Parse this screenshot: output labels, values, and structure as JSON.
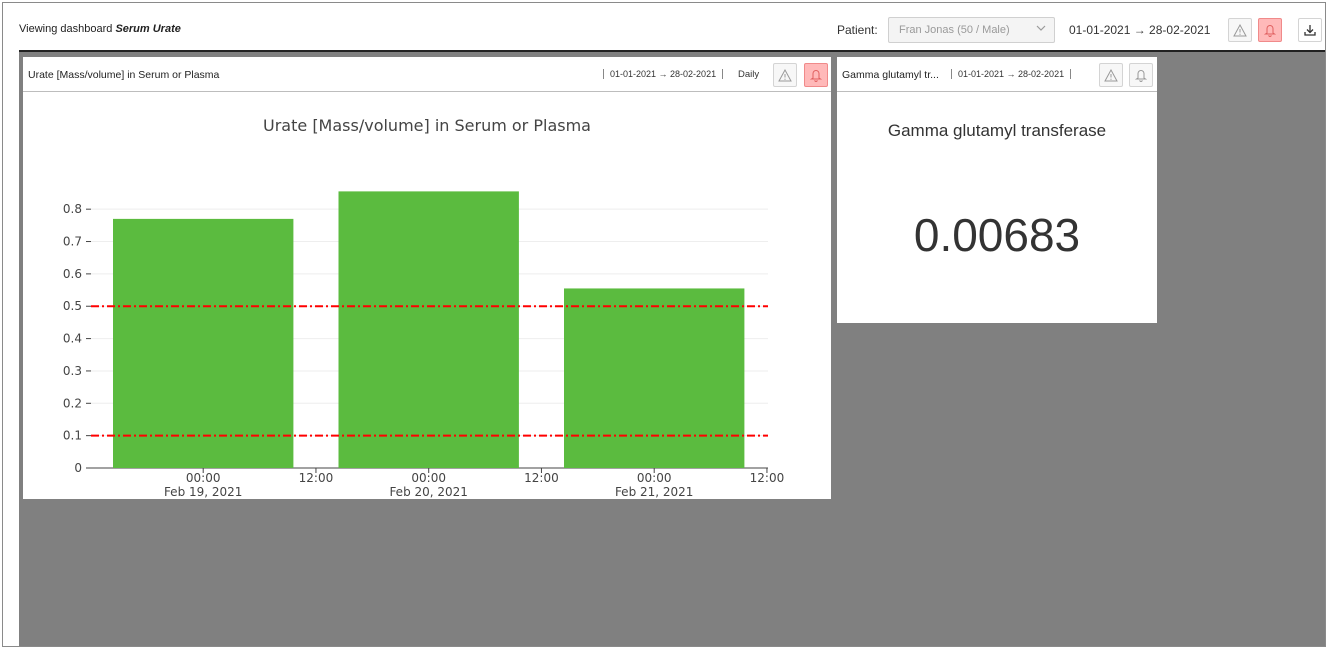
{
  "header": {
    "prefix": "Viewing dashboard",
    "dashboard_name": "Serum Urate",
    "patient_label": "Patient:",
    "patient_value": "Fran Jonas (50 / Male)",
    "date_range": "01-01-2021 → 28-02-2021"
  },
  "icons": {
    "warning": "warning-icon",
    "bell": "bell-icon",
    "download": "download-icon"
  },
  "colors": {
    "alert_bg": "#ffb9b9",
    "bar": "#5bbb3f",
    "threshold": "#ff0000"
  },
  "panels": {
    "urate": {
      "title": "Urate [Mass/volume] in Serum or Plasma",
      "date_range": "01-01-2021 → 28-02-2021",
      "granularity": "Daily",
      "bell_active": true
    },
    "ggt": {
      "title": "Gamma glutamyl tr...",
      "date_range": "01-01-2021 → 28-02-2021",
      "kpi_title": "Gamma glutamyl transferase",
      "kpi_value": "0.00683",
      "bell_active": false
    }
  },
  "chart_data": {
    "type": "bar",
    "title": "Urate [Mass/volume] in Serum or Plasma",
    "xlabel": "",
    "ylabel": "",
    "categories": [
      "2021-02-19",
      "2021-02-20",
      "2021-02-21"
    ],
    "values": [
      0.77,
      0.855,
      0.555
    ],
    "ylim": [
      0,
      0.85
    ],
    "yticks": [
      "0",
      "0.1",
      "0.2",
      "0.3",
      "0.4",
      "0.5",
      "0.6",
      "0.7",
      "0.8"
    ],
    "xtick_labels": [
      {
        "time": "00:00",
        "date": "Feb 19, 2021"
      },
      {
        "time": "12:00",
        "date": ""
      },
      {
        "time": "00:00",
        "date": "Feb 20, 2021"
      },
      {
        "time": "12:00",
        "date": ""
      },
      {
        "time": "00:00",
        "date": "Feb 21, 2021"
      },
      {
        "time": "12:00",
        "date": ""
      }
    ],
    "reference_lines": [
      0.5,
      0.1
    ],
    "grid": true
  }
}
